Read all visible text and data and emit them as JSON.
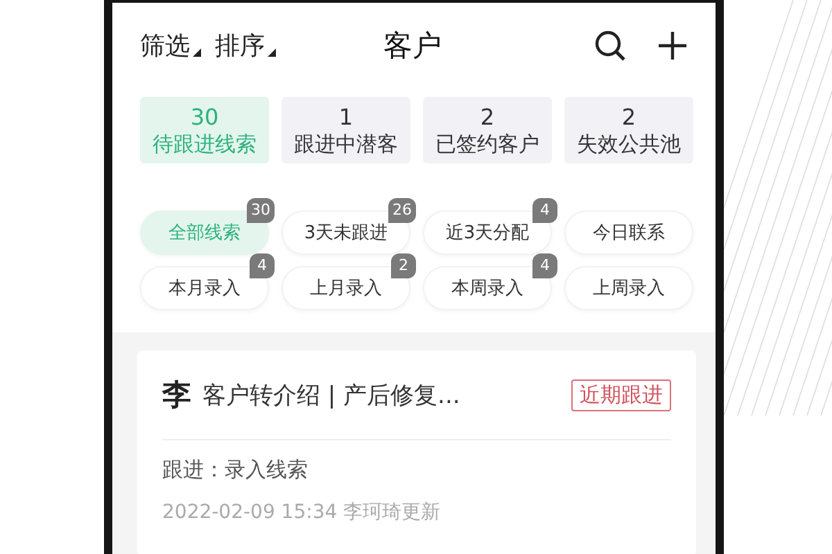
{
  "header": {
    "menus": [
      {
        "label": "筛选"
      },
      {
        "label": "排序"
      }
    ],
    "title": "客户"
  },
  "stats": [
    {
      "count": "30",
      "label": "待跟进线索",
      "selected": true
    },
    {
      "count": "1",
      "label": "跟进中潜客",
      "selected": false
    },
    {
      "count": "2",
      "label": "已签约客户",
      "selected": false
    },
    {
      "count": "2",
      "label": "失效公共池",
      "selected": false
    }
  ],
  "filters": [
    {
      "label": "全部线索",
      "badge": "30",
      "selected": true
    },
    {
      "label": "3天未跟进",
      "badge": "26",
      "selected": false
    },
    {
      "label": "近3天分配",
      "badge": "4",
      "selected": false
    },
    {
      "label": "今日联系",
      "selected": false
    },
    {
      "label": "本月录入",
      "badge": "4",
      "selected": false
    },
    {
      "label": "上月录入",
      "badge": "2",
      "selected": false
    },
    {
      "label": "本周录入",
      "badge": "4",
      "selected": false
    },
    {
      "label": "上周录入",
      "selected": false
    }
  ],
  "card": {
    "surname": "李",
    "title": "客户转介绍 | 产后修复...",
    "tag": "近期跟进",
    "followup": "跟进：录入线索",
    "meta": "2022-02-09 15:34 李珂琦更新"
  }
}
